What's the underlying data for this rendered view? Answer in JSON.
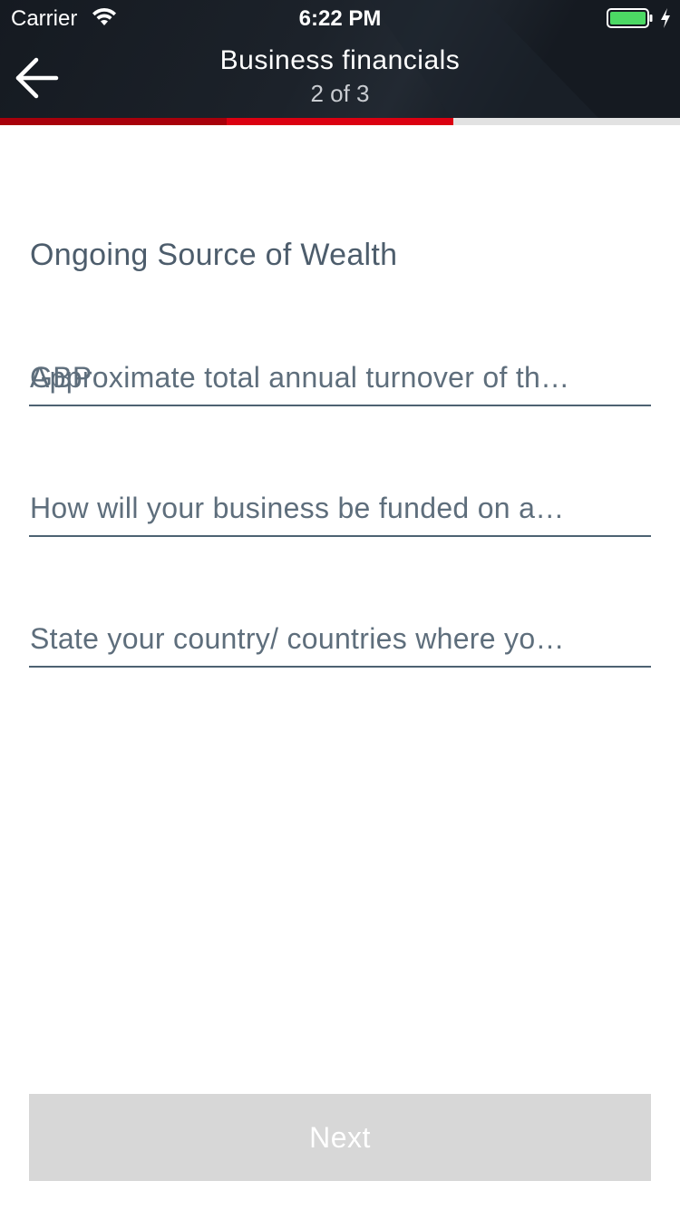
{
  "status_bar": {
    "carrier": "Carrier",
    "time": "6:22 PM",
    "icons": [
      "wifi-icon",
      "battery-icon",
      "bolt-icon"
    ]
  },
  "header": {
    "title": "Business financials",
    "step": "2 of 3",
    "back_icon": "back-arrow-icon",
    "progress": {
      "current_step": 2,
      "total_steps": 3
    }
  },
  "section": {
    "title": "Ongoing Source of Wealth"
  },
  "fields": [
    {
      "prefix": "GBP",
      "placeholder": "Approximate total annual turnover of th…"
    },
    {
      "placeholder": "How will your business be funded on a…"
    },
    {
      "placeholder": "State your country/ countries where yo…"
    }
  ],
  "actions": {
    "next_label": "Next"
  },
  "colors": {
    "header_bg": "#151a21",
    "progress_done": "#a8000b",
    "progress_current": "#db0011",
    "progress_todo": "#e2e2e2",
    "text_muted": "#5e6e7c",
    "button_disabled": "#d7d7d7"
  }
}
